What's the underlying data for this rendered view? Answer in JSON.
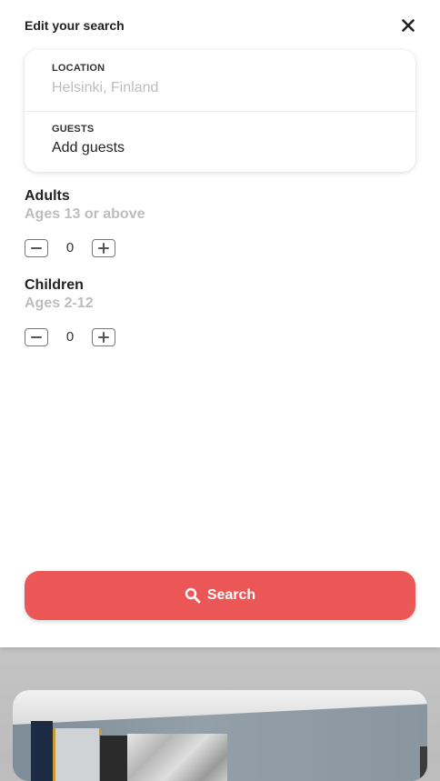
{
  "sheet": {
    "title": "Edit your search"
  },
  "search_card": {
    "location": {
      "label": "LOCATION",
      "placeholder": "Helsinki, Finland"
    },
    "guests": {
      "label": "GUESTS",
      "value": "Add guests"
    }
  },
  "adults": {
    "title": "Adults",
    "subtitle": "Ages 13 or above",
    "count": "0"
  },
  "children": {
    "title": "Children",
    "subtitle": "Ages 2-12",
    "count": "0"
  },
  "search_button": {
    "label": "Search"
  },
  "icons": {
    "close": "close-icon",
    "decrement": "minus-icon",
    "increment": "plus-icon",
    "search": "search-icon"
  },
  "colors": {
    "accent": "#EB5757",
    "text_primary": "#222222",
    "text_muted": "#BDBDBD"
  }
}
